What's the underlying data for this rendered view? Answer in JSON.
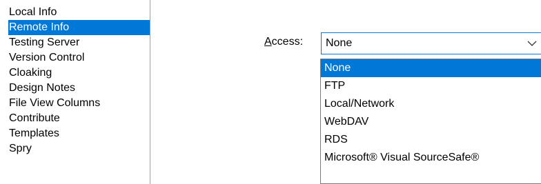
{
  "sidebar": {
    "items": [
      {
        "label": "Local Info"
      },
      {
        "label": "Remote Info",
        "selected": true
      },
      {
        "label": "Testing Server"
      },
      {
        "label": "Version Control"
      },
      {
        "label": "Cloaking"
      },
      {
        "label": "Design Notes"
      },
      {
        "label": "File View Columns"
      },
      {
        "label": "Contribute"
      },
      {
        "label": "Templates"
      },
      {
        "label": "Spry"
      }
    ]
  },
  "access": {
    "label_mnemonic": "A",
    "label_rest": "ccess:",
    "selected_value": "None",
    "options": [
      {
        "label": "None",
        "highlighted": true
      },
      {
        "label": "FTP"
      },
      {
        "label": "Local/Network"
      },
      {
        "label": "WebDAV"
      },
      {
        "label": "RDS"
      },
      {
        "label": "Microsoft® Visual SourceSafe®"
      }
    ]
  },
  "icons": {
    "dropdown_arrow": "chevron-down-icon"
  },
  "colors": {
    "selection": "#0078d7",
    "selection_text": "#ffffff",
    "divider": "#a0a0a0",
    "dropdown_border": "#7a7a7a"
  }
}
